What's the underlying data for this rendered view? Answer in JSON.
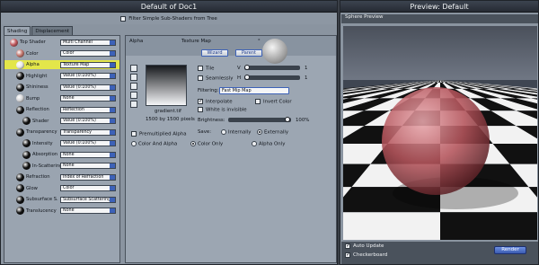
{
  "left_window": {
    "title": "Default of Doc1",
    "filter_label": "Filter Simple Sub-Shaders from Tree",
    "tabs": [
      {
        "label": "Shading"
      },
      {
        "label": "Displacement"
      }
    ],
    "properties": [
      {
        "label": "Top Shader",
        "value": "Multi Channel",
        "ball_color": "#c25b60"
      },
      {
        "label": "Color",
        "value": "Color",
        "ball_color": "#c4776f"
      },
      {
        "label": "Alpha",
        "value": "Texture Map",
        "ball_color": "#e8e8ea",
        "highlighted": true
      },
      {
        "label": "Highlight",
        "value": "Value (0:100%)",
        "ball_color": "#111111"
      },
      {
        "label": "Shininess",
        "value": "Value (0:100%)",
        "ball_color": "#111111"
      },
      {
        "label": "Bump",
        "value": "None",
        "ball_color": "#d8d8da"
      },
      {
        "label": "Reflection",
        "value": "Reflection",
        "ball_color": "#111111"
      },
      {
        "label": "Shader",
        "value": "Value (0:100%)",
        "ball_color": "#111111"
      },
      {
        "label": "Transparency",
        "value": "Transparency",
        "ball_color": "#111111"
      },
      {
        "label": "Intensity",
        "value": "Value (0:100%)",
        "ball_color": "#111111"
      },
      {
        "label": "Absorption",
        "value": "None",
        "ball_color": "#111111"
      },
      {
        "label": "In-Scattering",
        "value": "None",
        "ball_color": "#111111"
      },
      {
        "label": "Refraction",
        "value": "Index of Refraction",
        "ball_color": "#111111"
      },
      {
        "label": "Glow",
        "value": "Color",
        "ball_color": "#111111"
      },
      {
        "label": "Subsurface S.",
        "value": "Subsurface Scattering",
        "ball_color": "#111111"
      },
      {
        "label": "Translucency",
        "value": "None",
        "ball_color": "#111111"
      }
    ],
    "detail": {
      "header_label": "Alpha",
      "section_label": "Texture Map",
      "wizard_button": "Wizard",
      "parent_button": "Parent",
      "texture_name": "gradient.tif",
      "texture_size": "1500 by 1500 pixels",
      "tile_label": "Tile",
      "seamlessly_label": "Seamlessly",
      "v_label": "V",
      "h_label": "H",
      "v_value": "1",
      "h_value": "1",
      "filtering_label": "Filtering:",
      "filtering_value": "Fast Mip Map",
      "interpolate_label": "Interpolate",
      "invert_color_label": "Invert Color",
      "white_invisible_label": "White is invisible",
      "brightness_label": "Brightness:",
      "brightness_value": "100%",
      "premultiplied_label": "Premultiplied Alpha",
      "save_label": "Save:",
      "internally_label": "Internally",
      "externally_label": "Externally",
      "color_and_alpha_label": "Color And Alpha",
      "color_only_label": "Color Only",
      "alpha_only_label": "Alpha Only"
    }
  },
  "right_window": {
    "title": "Preview: Default",
    "subtitle": "Sphere Preview",
    "auto_update_label": "Auto Update",
    "checkerboard_label": "Checkerboard",
    "render_button": "Render"
  },
  "colors": {
    "highlight_row": "#e3e64a",
    "accent_blue": "#3d62b8",
    "sphere_color": "#b5555c"
  }
}
